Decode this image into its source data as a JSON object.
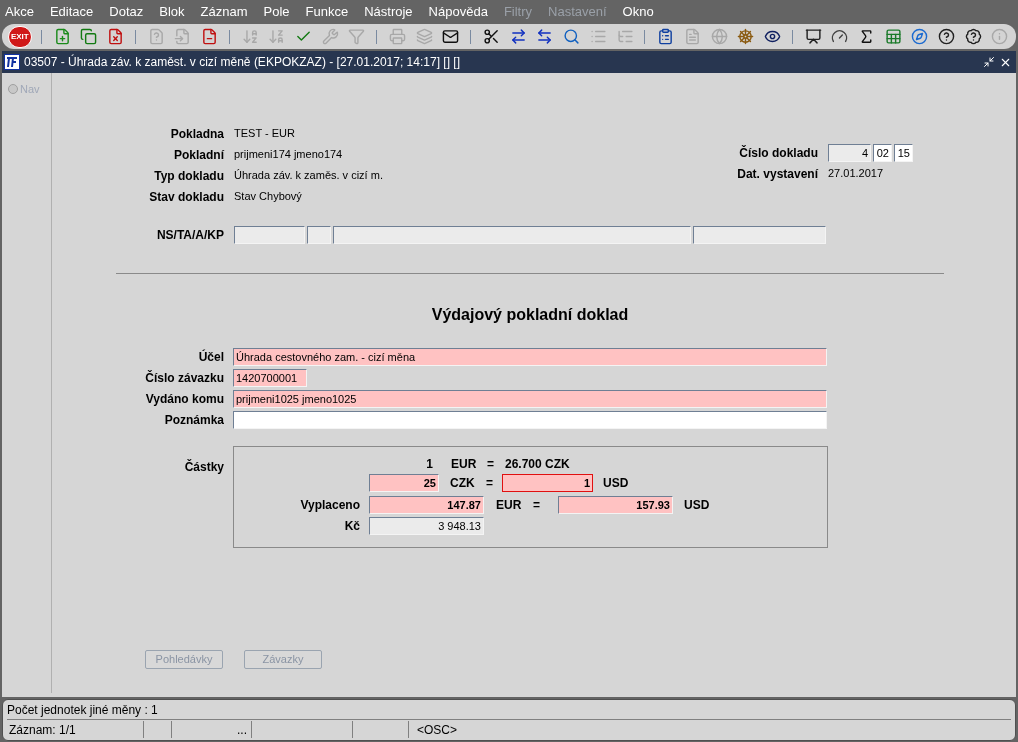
{
  "menu": [
    {
      "label": "Akce",
      "disabled": false
    },
    {
      "label": "Editace",
      "disabled": false
    },
    {
      "label": "Dotaz",
      "disabled": false
    },
    {
      "label": "Blok",
      "disabled": false
    },
    {
      "label": "Záznam",
      "disabled": false
    },
    {
      "label": "Pole",
      "disabled": false
    },
    {
      "label": "Funkce",
      "disabled": false
    },
    {
      "label": "Nástroje",
      "disabled": false
    },
    {
      "label": "Nápověda",
      "disabled": false
    },
    {
      "label": "Filtry",
      "disabled": true
    },
    {
      "label": "Nastavení",
      "disabled": true
    },
    {
      "label": "Okno",
      "disabled": false
    }
  ],
  "toolbar": {
    "exit_label": "EXIT",
    "groups": [
      [
        {
          "disabled": false
        },
        {
          "disabled": false
        },
        {
          "disabled": false
        }
      ],
      [
        {
          "disabled": true
        },
        {
          "disabled": true
        },
        {
          "disabled": false
        }
      ],
      [
        {
          "disabled": true
        },
        {
          "disabled": true
        },
        {
          "disabled": false
        },
        {
          "disabled": true
        },
        {
          "disabled": true
        }
      ],
      [
        {
          "disabled": true
        },
        {
          "disabled": true
        },
        {
          "disabled": false
        }
      ],
      [
        {
          "disabled": false
        },
        {
          "disabled": false
        },
        {
          "disabled": false
        },
        {
          "disabled": false
        },
        {
          "disabled": true
        },
        {
          "disabled": true
        }
      ],
      [
        {
          "disabled": false
        },
        {
          "disabled": true
        },
        {
          "disabled": true
        },
        {
          "disabled": false
        },
        {
          "disabled": false
        }
      ],
      [
        {
          "disabled": false
        },
        {
          "disabled": false
        },
        {
          "disabled": false
        },
        {
          "disabled": false
        },
        {
          "disabled": false
        },
        {
          "disabled": false
        },
        {
          "disabled": false
        },
        {
          "disabled": true
        }
      ]
    ]
  },
  "window": {
    "title": "03507 - Úhrada záv. k zaměst. v cizí měně (EKPOKZAZ) - [27.01.2017; 14:17] [] []"
  },
  "nav": {
    "label": "Nav",
    "selected": false
  },
  "header": {
    "left": [
      {
        "label": "Pokladna",
        "value": "TEST - EUR"
      },
      {
        "label": "Pokladní",
        "value": "prijmeni174 jmeno174"
      },
      {
        "label": "Typ dokladu",
        "value": "Úhrada záv. k zaměs. v cizí m."
      },
      {
        "label": "Stav dokladu",
        "value": "Stav Chybový"
      }
    ],
    "doc_number": {
      "label": "Číslo dokladu",
      "fields": [
        {
          "value": "4",
          "kind": "readonly"
        },
        {
          "value": "02",
          "kind": "optional"
        },
        {
          "value": "15",
          "kind": "optional"
        }
      ]
    },
    "issue_date": {
      "label": "Dat. vystavení",
      "value": "27.01.2017"
    },
    "ns_ta_a_kp": {
      "label": "NS/TA/A/KP",
      "fields": [
        {
          "kind": "readonly"
        },
        {
          "kind": "readonly"
        },
        {
          "kind": "readonly"
        },
        {
          "kind": "readonly"
        }
      ]
    }
  },
  "form_title": "Výdajový pokladní doklad",
  "fields": [
    {
      "label": "Účel",
      "value": "Úhrada cestovného zam. - cizí měna",
      "kind": "required"
    },
    {
      "label": "Číslo závazku",
      "value": "1420700001",
      "kind": "required"
    },
    {
      "label": "Vydáno komu",
      "value": "prijmeni1025 jmeno1025",
      "kind": "required"
    },
    {
      "label": "Poznámka",
      "kind": "optional"
    }
  ],
  "amounts": {
    "label": "Částky",
    "rate": {
      "units": "1",
      "currency": "EUR",
      "equals": "=",
      "value": "26.700 CZK"
    },
    "conversion": {
      "czk": {
        "value": "25",
        "kind": "required",
        "focused": false
      },
      "czk_label": "CZK",
      "equals": "=",
      "usd": {
        "value": "1",
        "kind": "required",
        "focused": true
      },
      "usd_label": "USD"
    },
    "paid": {
      "label": "Vyplaceno",
      "eur": {
        "value": "147.87",
        "kind": "required",
        "focused": false
      },
      "eur_label": "EUR",
      "equals": "=",
      "usd": {
        "value": "157.93",
        "kind": "required",
        "focused": false
      },
      "usd_label": "USD"
    },
    "czk_total": {
      "label": "Kč",
      "field": {
        "value": "3 948.13",
        "kind": "readonly",
        "focused": false
      }
    }
  },
  "buttons": [
    {
      "label": "Pohledávky",
      "disabled": true
    },
    {
      "label": "Závazky",
      "disabled": true
    }
  ],
  "status_bar": {
    "message": "Počet jednotek jiné měny : 1",
    "cells": [
      {
        "text": "Záznam: 1/1"
      },
      {
        "text": "..."
      },
      {
        "text": "<OSC>"
      }
    ]
  }
}
